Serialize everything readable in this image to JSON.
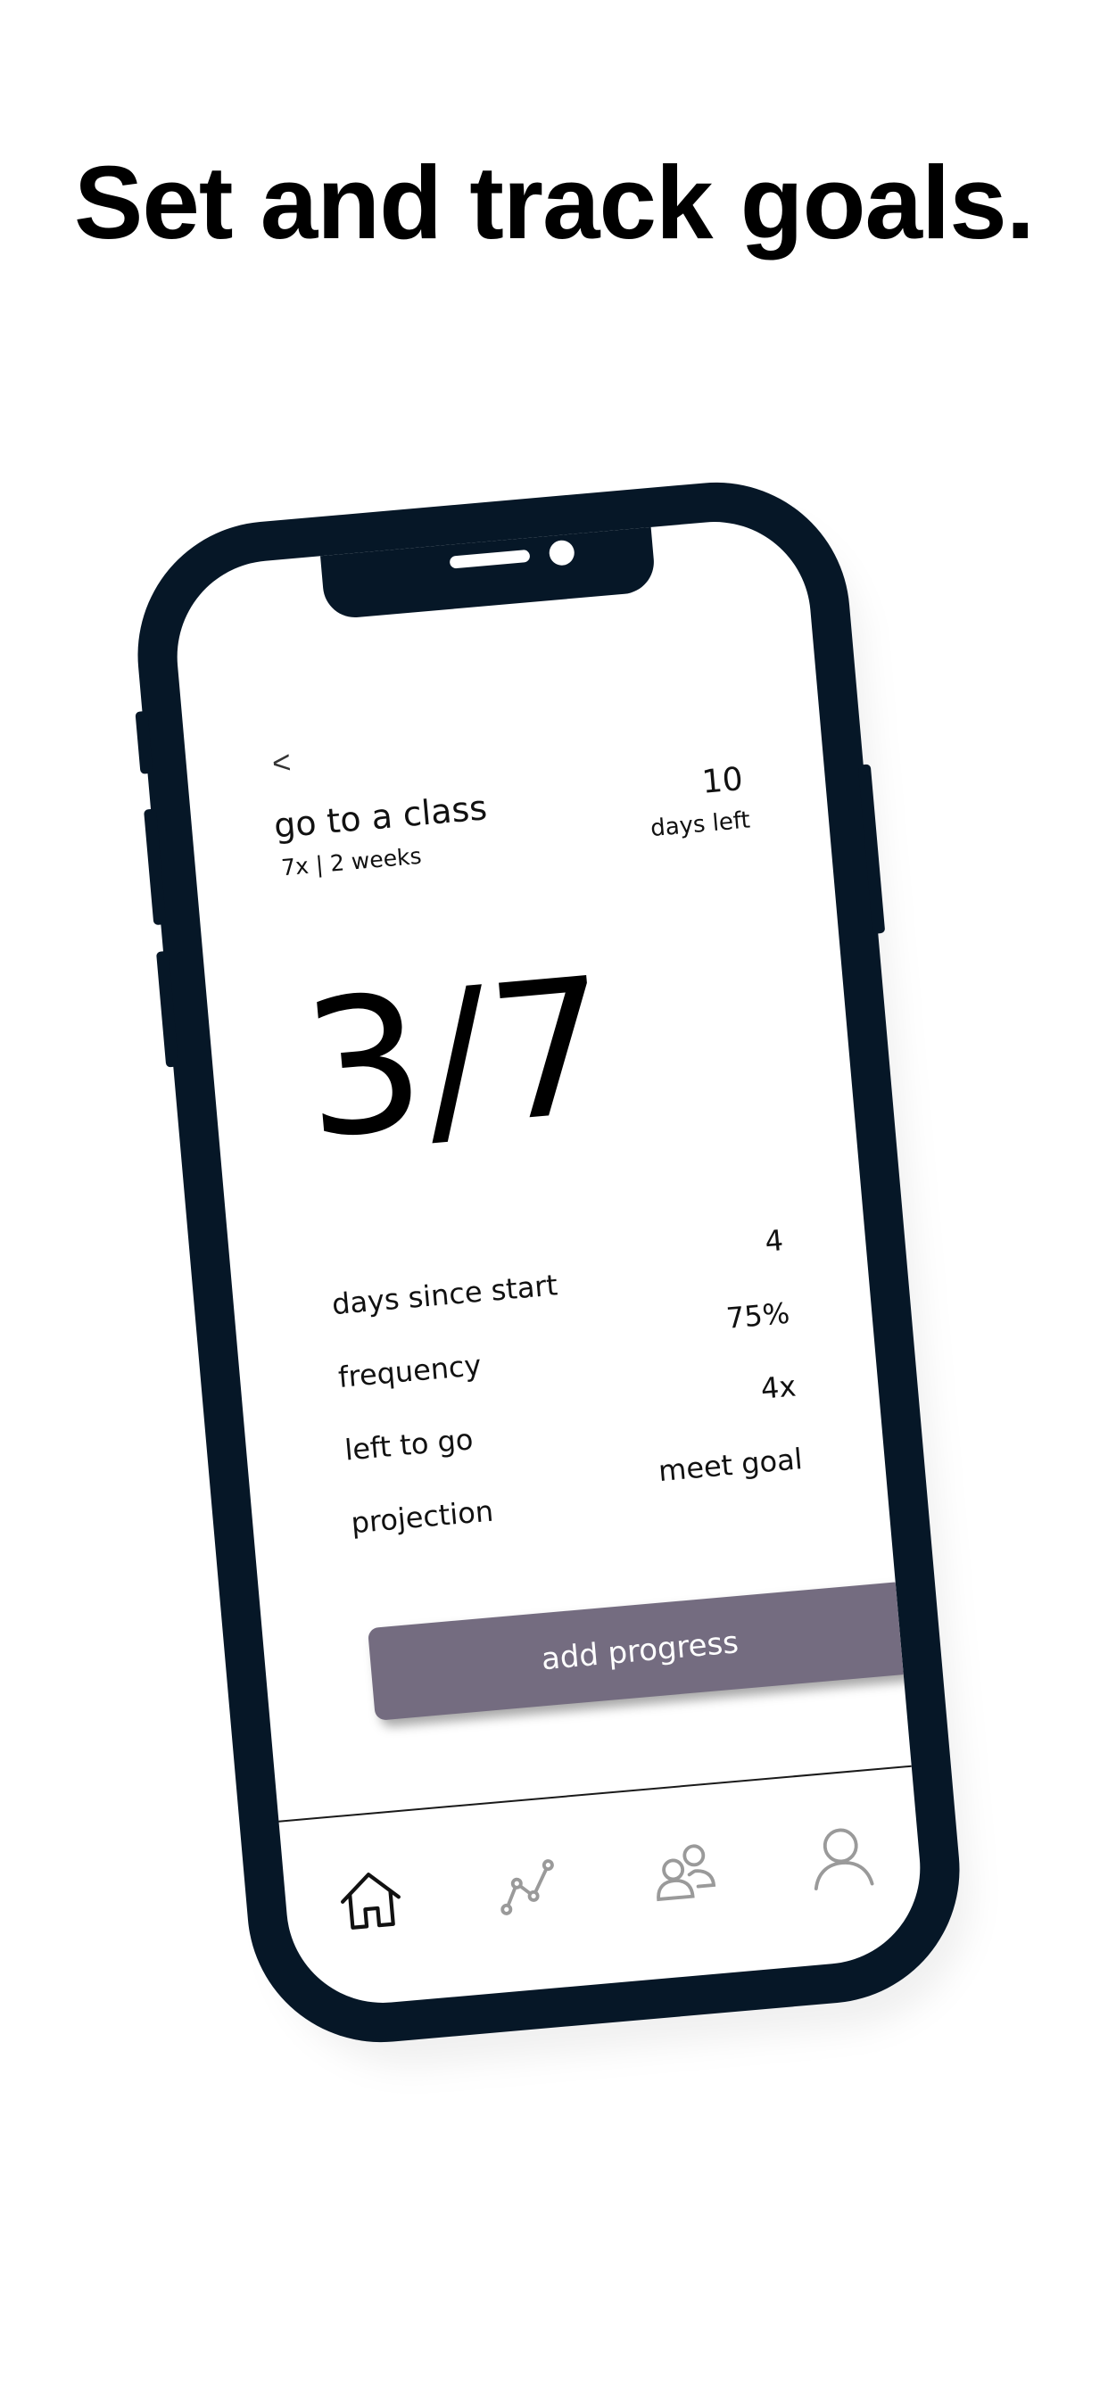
{
  "headline": "Set and track goals.",
  "screen": {
    "back_label": "<",
    "goal": {
      "title": "go to a class",
      "subtitle": "7x | 2 weeks"
    },
    "days_left": {
      "value": "10",
      "label": "days left"
    },
    "progress_count": "3/7",
    "stats": [
      {
        "label": "days since start",
        "value": "4"
      },
      {
        "label": "frequency",
        "value": "75%"
      },
      {
        "label": "left to go",
        "value": "4x"
      },
      {
        "label": "projection",
        "value": "meet goal"
      }
    ],
    "add_button_label": "add progress",
    "add_button_color": "#746c80",
    "tab_bar": [
      {
        "icon": "home-icon",
        "active": true
      },
      {
        "icon": "trend-chart-icon",
        "active": false
      },
      {
        "icon": "group-icon",
        "active": false
      },
      {
        "icon": "profile-icon",
        "active": false
      }
    ]
  },
  "colors": {
    "phone_frame": "#061727",
    "inactive_icon": "#9a9a9a",
    "active_icon": "#111111"
  }
}
